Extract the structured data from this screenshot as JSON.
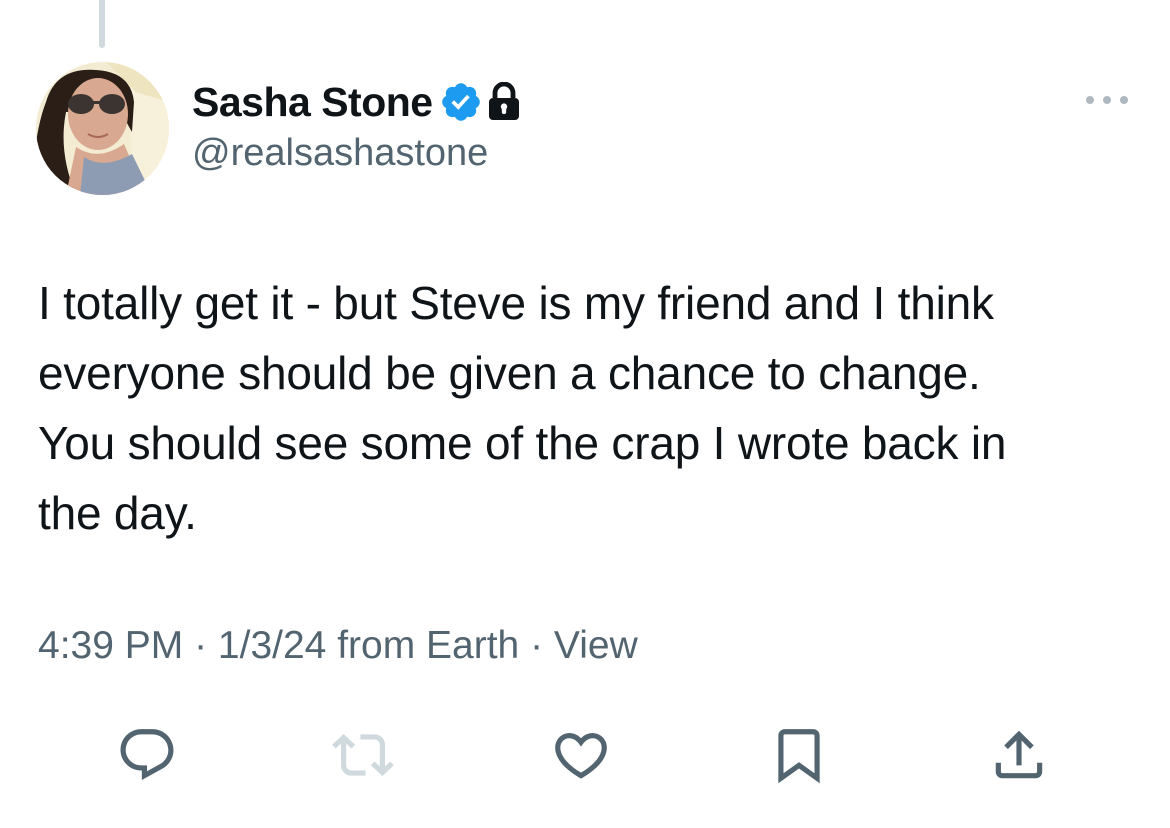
{
  "tweet": {
    "author": {
      "display_name": "Sasha Stone",
      "handle": "@realsashastone",
      "verified": true,
      "protected": true
    },
    "text_lines": [
      "I totally get it - but Steve is my friend and I think",
      "everyone should be given a chance to change.",
      "You should see some of the crap I wrote back in",
      "the day."
    ],
    "meta": {
      "time": "4:39 PM",
      "separator1": " · ",
      "date": "1/3/24",
      "source": " from Earth",
      "separator2": " · ",
      "view_label": "View"
    },
    "actions": [
      {
        "name": "reply",
        "icon": "reply-icon"
      },
      {
        "name": "retweet",
        "icon": "retweet-icon"
      },
      {
        "name": "like",
        "icon": "heart-icon"
      },
      {
        "name": "bookmark",
        "icon": "bookmark-icon"
      },
      {
        "name": "share",
        "icon": "share-icon"
      }
    ]
  },
  "colors": {
    "text_primary": "#0f1419",
    "text_secondary": "#536471",
    "verified_blue": "#1d9bf0",
    "retweet_disabled": "#cfd9de",
    "thread_line": "#cfd9de"
  }
}
